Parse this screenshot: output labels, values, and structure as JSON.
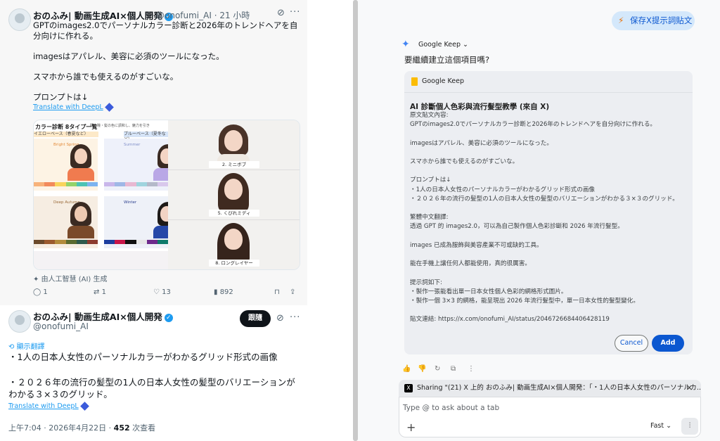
{
  "tweet1": {
    "author_name": "おのふみ| 動画生成AI×個人開発",
    "handle_time": "@onofumi_AI · 21 小時",
    "body": "GPTのimages2.0でパーソナルカラー診断と2026年のトレンドヘアを自分向けに作れる。\n\nimagesはアパレル、美容に必須のツールになった。\n\nスマホから誰でも使えるのがすごいな。\n\nプロンプトは↓",
    "translate_label": "Translate with DeepL",
    "chart_image": {
      "title": "カラー診断 8タイプ一覧",
      "subtitle": "肌・瞳・髪の色に調和し、魅力を引き",
      "segment_left": "イエローベース（春夏など）",
      "segment_right": "ブルーベース（夏冬など）",
      "types": [
        "Bright Spring",
        "Summer",
        "Deep Autumn",
        "Winter"
      ],
      "ps_label": "Ps"
    },
    "hair_image": {
      "labels": [
        "2. ミニボブ",
        "5. くびれミディ",
        "8. ロングレイヤー"
      ]
    },
    "ai_generated": "由人工智慧 (AI) 生成",
    "actions": {
      "replies": "1",
      "retweets": "1",
      "likes": "13",
      "views": "892"
    }
  },
  "tweet2": {
    "author_name": "おのふみ| 動画生成AI×個人開発",
    "handle": "@onofumi_AI",
    "follow_label": "跟隨",
    "show_translation": "顯示翻譯",
    "line1": "・1人の日本人女性のパーソナルカラーがわかるグリッド形式の画像",
    "line2": "・２０２６年の流行の髪型の1人の日本人女性の髪型のバリエーションが\nわかる３×３のグリッド。",
    "translate_label": "Translate with DeepL",
    "time": "上午7:04 · 2026年4月22日 · ",
    "views_count": "452",
    "views_suffix": " 次查看"
  },
  "panel": {
    "save_button": "保存X提示詞貼文",
    "app_name": "Google Keep",
    "question": "要繼續建立這個項目嗎?",
    "card_app_label": "Google Keep",
    "card_title": "AI 診斷個人色彩與流行髮型教學 (來自 X)",
    "card_body": "原文貼文內容:\nGPTのimages2.0でパーソナルカラー診断と2026年のトレンドヘアを自分向けに作れる。\n\nimagesはアパレル、美容に必須のツールになった。\n\nスマホから誰でも使えるのがすごいな。\n\nプロンプトは↓\n・1人の日本人女性のパーソナルカラーがわかるグリッド形式の画像\n・２０２６年の流行の髪型の1人の日本人女性の髪型のバリエーションがわかる３×３のグリッド。\n\n繁體中文翻譯:\n透過 GPT 的 images2.0，可以為自己製作個人色彩診斷和 2026 年流行髮型。\n\nimages 已成為服飾與美容產業不可或缺的工具。\n\n能在手機上讓任何人都能使用，真的很厲害。\n\n提示詞如下:\n・製作一張能看出單一日本女性個人色彩的網格形式圖片。\n・製作一個 3×3 的網格，能呈現出 2026 年流行髮型中，單一日本女性的髮型變化。\n\n貼文連結: https://x.com/onofumi_AI/status/2046726684406428119",
    "cancel": "Cancel",
    "add": "Add",
    "sharing": "Sharing \"(21) X 上的 おのふみ| 動画生成AI×個人開発：「・1人の日本人女性のパーソナルカ... \"",
    "input_placeholder": "Type @ to ask about a tab",
    "model": "Fast"
  }
}
